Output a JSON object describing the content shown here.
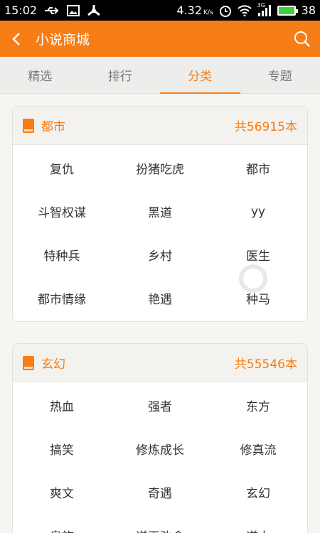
{
  "status_bar": {
    "time": "15:02",
    "speed": "4.32",
    "speed_unit": "K/s",
    "network": "3G",
    "battery": "38"
  },
  "appbar": {
    "title": "小说商城"
  },
  "tabs": [
    {
      "label": "精选"
    },
    {
      "label": "排行"
    },
    {
      "label": "分类"
    },
    {
      "label": "专题"
    }
  ],
  "categories": [
    {
      "name": "都市",
      "count": "共56915本",
      "tags": [
        "复仇",
        "扮猪吃虎",
        "都市",
        "斗智权谋",
        "黑道",
        "yy",
        "特种兵",
        "乡村",
        "医生",
        "都市情缘",
        "艳遇",
        "种马"
      ]
    },
    {
      "name": "玄幻",
      "count": "共55546本",
      "tags": [
        "热血",
        "强者",
        "东方",
        "搞笑",
        "修炼成长",
        "修真流",
        "爽文",
        "奇遇",
        "玄幻",
        "皇族",
        "逆天改命",
        "道士"
      ]
    }
  ],
  "colors": {
    "accent": "#f77d16",
    "status_bg": "#000000"
  }
}
